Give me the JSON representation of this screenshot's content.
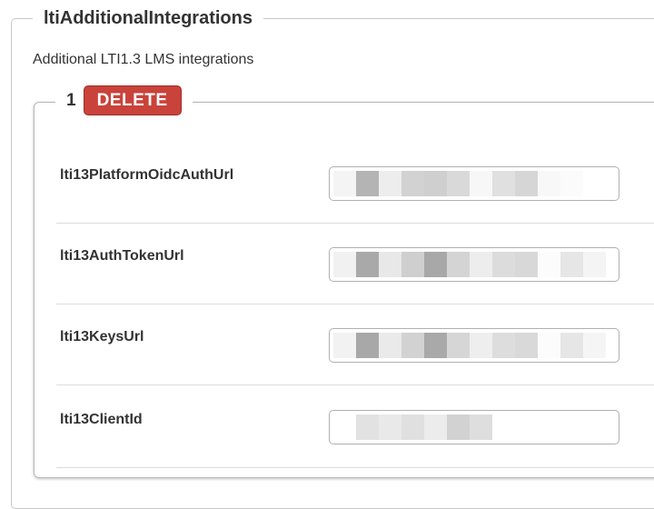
{
  "section": {
    "title": "ltiAdditionalIntegrations",
    "description": "Additional LTI1.3 LMS integrations"
  },
  "integration": {
    "index": "1",
    "delete_label": "DELETE",
    "fields": [
      {
        "label": "lti13PlatformOidcAuthUrl",
        "value_redacted": true
      },
      {
        "label": "lti13AuthTokenUrl",
        "value_redacted": true
      },
      {
        "label": "lti13KeysUrl",
        "value_redacted": true
      },
      {
        "label": "lti13ClientId",
        "value_redacted": true
      }
    ]
  },
  "colors": {
    "delete_button": "#c9433b",
    "border": "#c8c8c8",
    "text": "#333333"
  }
}
